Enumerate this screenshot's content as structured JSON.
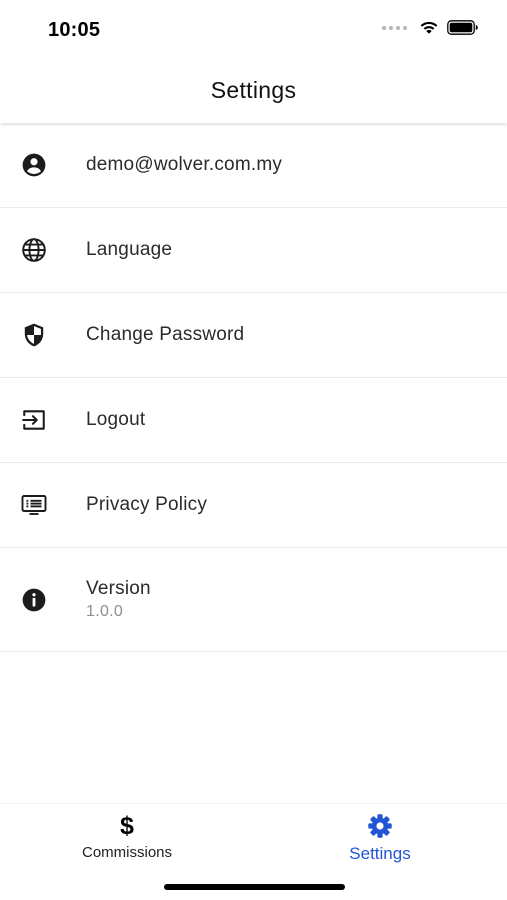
{
  "status_bar": {
    "time": "10:05"
  },
  "header": {
    "title": "Settings"
  },
  "settings": {
    "items": [
      {
        "label": "demo@wolver.com.my",
        "icon": "account-circle-icon"
      },
      {
        "label": "Language",
        "icon": "globe-icon"
      },
      {
        "label": "Change Password",
        "icon": "shield-icon"
      },
      {
        "label": "Logout",
        "icon": "logout-icon"
      },
      {
        "label": "Privacy Policy",
        "icon": "policy-document-icon"
      },
      {
        "label": "Version",
        "sublabel": "1.0.0",
        "icon": "info-icon"
      }
    ]
  },
  "tab_bar": {
    "tabs": [
      {
        "label": "Commissions",
        "icon": "dollar-icon",
        "active": false
      },
      {
        "label": "Settings",
        "icon": "gear-icon",
        "active": true
      }
    ]
  },
  "colors": {
    "accent": "#2255d4",
    "text": "#2b2b2b",
    "subtext": "#8e8e93",
    "divider": "#ececec"
  }
}
